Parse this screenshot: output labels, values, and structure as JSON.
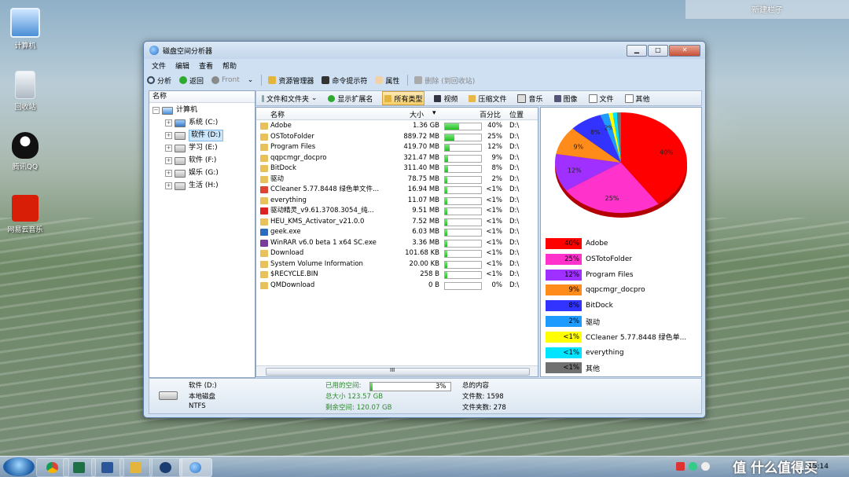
{
  "desktop": {
    "top_right_tab": "新建栏子",
    "icons": [
      {
        "label": "计算机",
        "icon": "computer-icon"
      },
      {
        "label": "回收站",
        "icon": "recycle-bin-icon"
      },
      {
        "label": "腾讯QQ",
        "icon": "qq-icon"
      },
      {
        "label": "网易云音乐",
        "icon": "netease-music-icon"
      }
    ]
  },
  "window": {
    "title": "磁盘空间分析器",
    "menu": [
      "文件",
      "编辑",
      "查看",
      "帮助"
    ],
    "toolbar": {
      "analyze": "分析",
      "back": "返回",
      "front": "Front",
      "explorer": "资源管理器",
      "cmd": "命令提示符",
      "properties": "属性",
      "delete": "删除 (到回收站)"
    },
    "tree": {
      "header": "名称",
      "root": "计算机",
      "drives": [
        "系统 (C:)",
        "软件 (D:)",
        "学习 (E:)",
        "软件 (F:)",
        "娱乐 (G:)",
        "生活 (H:)"
      ],
      "selected_index": 1
    },
    "typebar": {
      "files_folders": "文件和文件夹",
      "show_ext": "显示扩展名",
      "all_types": "所有类型",
      "video": "视频",
      "archive": "压缩文件",
      "music": "音乐",
      "image": "图像",
      "document": "文件",
      "other": "其他"
    },
    "list": {
      "columns": {
        "name": "名称",
        "size": "大小",
        "percent": "百分比",
        "location": "位置"
      },
      "rows": [
        {
          "name": "Adobe",
          "size": "1.36 GB",
          "percent": "40%",
          "fill": 0.4,
          "loc": "D:\\",
          "icon": "folder-icon"
        },
        {
          "name": "OSTotoFolder",
          "size": "889.72 MB",
          "percent": "25%",
          "fill": 0.25,
          "loc": "D:\\",
          "icon": "folder-icon"
        },
        {
          "name": "Program Files",
          "size": "419.70 MB",
          "percent": "12%",
          "fill": 0.12,
          "loc": "D:\\",
          "icon": "folder-icon"
        },
        {
          "name": "qqpcmgr_docpro",
          "size": "321.47 MB",
          "percent": "9%",
          "fill": 0.09,
          "loc": "D:\\",
          "icon": "folder-icon"
        },
        {
          "name": "BitDock",
          "size": "311.40 MB",
          "percent": "8%",
          "fill": 0.08,
          "loc": "D:\\",
          "icon": "folder-icon"
        },
        {
          "name": "驱动",
          "size": "78.75 MB",
          "percent": "2%",
          "fill": 0.02,
          "loc": "D:\\",
          "icon": "folder-icon"
        },
        {
          "name": "CCleaner 5.77.8448 绿色单文件...",
          "size": "16.94 MB",
          "percent": "<1%",
          "fill": 0.01,
          "loc": "D:\\",
          "icon": "ccleaner-icon"
        },
        {
          "name": "everything",
          "size": "11.07 MB",
          "percent": "<1%",
          "fill": 0.01,
          "loc": "D:\\",
          "icon": "folder-icon"
        },
        {
          "name": "驱动精灵_v9.61.3708.3054_纯...",
          "size": "9.51 MB",
          "percent": "<1%",
          "fill": 0.01,
          "loc": "D:\\",
          "icon": "drivergenius-icon"
        },
        {
          "name": "HEU_KMS_Activator_v21.0.0",
          "size": "7.52 MB",
          "percent": "<1%",
          "fill": 0.01,
          "loc": "D:\\",
          "icon": "folder-icon"
        },
        {
          "name": "geek.exe",
          "size": "6.03 MB",
          "percent": "<1%",
          "fill": 0.01,
          "loc": "D:\\",
          "icon": "exe-icon"
        },
        {
          "name": "WinRAR v6.0 beta 1 x64 SC.exe",
          "size": "3.36 MB",
          "percent": "<1%",
          "fill": 0.01,
          "loc": "D:\\",
          "icon": "winrar-icon"
        },
        {
          "name": "Download",
          "size": "101.68 KB",
          "percent": "<1%",
          "fill": 0.01,
          "loc": "D:\\",
          "icon": "folder-icon"
        },
        {
          "name": "System Volume Information",
          "size": "20.00 KB",
          "percent": "<1%",
          "fill": 0.01,
          "loc": "D:\\",
          "icon": "folder-icon"
        },
        {
          "name": "$RECYCLE.BIN",
          "size": "258 B",
          "percent": "<1%",
          "fill": 0.01,
          "loc": "D:\\",
          "icon": "folder-icon"
        },
        {
          "name": "QMDownload",
          "size": "0 B",
          "percent": "0%",
          "fill": 0,
          "loc": "D:\\",
          "icon": "folder-icon"
        }
      ],
      "hscroll_label": "III"
    },
    "status": {
      "drive": "软件 (D:)",
      "type": "本地磁盘",
      "fs": "NTFS",
      "used_label": "已用的空间:",
      "used_percent": "3%",
      "used_fill": 0.03,
      "total": "总大小 123.57 GB",
      "free": "剩余空间: 120.07 GB",
      "content_label": "总的内容",
      "file_count": "文件数: 1598",
      "folder_count": "文件夹数: 278"
    }
  },
  "chart_data": {
    "type": "pie",
    "slices": [
      {
        "name": "Adobe",
        "value": 40,
        "label": "40%",
        "color": "#ff0000"
      },
      {
        "name": "OSTotoFolder",
        "value": 25,
        "label": "25%",
        "color": "#ff33cc"
      },
      {
        "name": "Program Files",
        "value": 12,
        "label": "12%",
        "color": "#a030ff"
      },
      {
        "name": "qqpcmgr_docpro",
        "value": 9,
        "label": "9%",
        "color": "#ff8c1a"
      },
      {
        "name": "BitDock",
        "value": 8,
        "label": "8%",
        "color": "#3333ff"
      },
      {
        "name": "驱动",
        "value": 2,
        "label": "2%",
        "color": "#1e9bff"
      },
      {
        "name": "CCleaner 5.77.8448 绿色单...",
        "value": 1,
        "label": "<1%",
        "color": "#ffff00"
      },
      {
        "name": "everything",
        "value": 1,
        "label": "<1%",
        "color": "#00e5ff"
      },
      {
        "name": "其他",
        "value": 1,
        "label": "<1%",
        "color": "#707070"
      }
    ]
  },
  "taskbar": {
    "clock": "15:14",
    "watermark": "值 什么值得买",
    "apps": [
      "start-orb",
      "chrome-icon",
      "excel-icon",
      "word-icon",
      "explorer-icon",
      "app-icon",
      "disk-analyzer-icon"
    ]
  }
}
